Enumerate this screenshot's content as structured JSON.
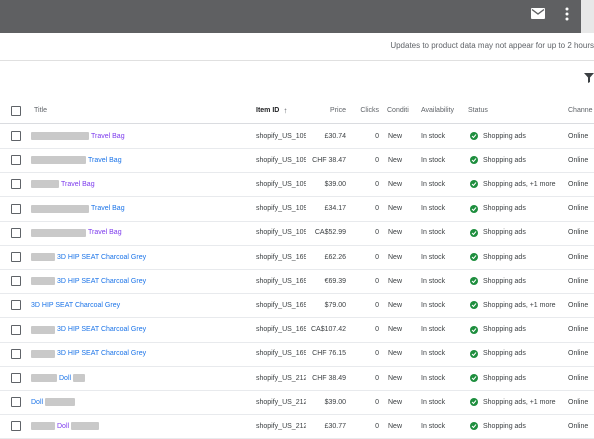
{
  "topbar": {
    "icons": [
      "mail-icon",
      "more-vert-icon"
    ]
  },
  "notice": "Updates to product data may not appear for up to 2 hours",
  "columns": {
    "title": "Title",
    "item_id": "Item ID",
    "price": "Price",
    "clicks": "Clicks",
    "condition": "Conditi",
    "availability": "Availability",
    "status": "Status",
    "channel": "Channe"
  },
  "rows": [
    {
      "title": "Travel Bag",
      "visited": true,
      "blur_lead": 58,
      "blur_tail": 0,
      "item_id": "shopify_US_109",
      "price": "£30.74",
      "clicks": "0",
      "condition": "New",
      "availability": "In stock",
      "status": "Shopping ads",
      "channel": "Online"
    },
    {
      "title": "Travel Bag",
      "visited": false,
      "blur_lead": 55,
      "blur_tail": 0,
      "item_id": "shopify_US_109",
      "price": "CHF 38.47",
      "clicks": "0",
      "condition": "New",
      "availability": "In stock",
      "status": "Shopping ads",
      "channel": "Online"
    },
    {
      "title": "Travel Bag",
      "visited": true,
      "blur_lead": 28,
      "blur_tail": 0,
      "item_id": "shopify_US_109",
      "price": "$39.00",
      "clicks": "0",
      "condition": "New",
      "availability": "In stock",
      "status": "Shopping ads, +1 more",
      "channel": "Online"
    },
    {
      "title": "Travel Bag",
      "visited": false,
      "blur_lead": 58,
      "blur_tail": 0,
      "item_id": "shopify_US_109",
      "price": "£34.17",
      "clicks": "0",
      "condition": "New",
      "availability": "In stock",
      "status": "Shopping ads",
      "channel": "Online"
    },
    {
      "title": "Travel Bag",
      "visited": true,
      "blur_lead": 55,
      "blur_tail": 0,
      "item_id": "shopify_US_109",
      "price": "CA$52.99",
      "clicks": "0",
      "condition": "New",
      "availability": "In stock",
      "status": "Shopping ads",
      "channel": "Online"
    },
    {
      "title": "3D HIP SEAT Charcoal Grey",
      "visited": false,
      "blur_lead": 24,
      "blur_tail": 0,
      "item_id": "shopify_US_169",
      "price": "£62.26",
      "clicks": "0",
      "condition": "New",
      "availability": "In stock",
      "status": "Shopping ads",
      "channel": "Online"
    },
    {
      "title": "3D HIP SEAT Charcoal Grey",
      "visited": false,
      "blur_lead": 24,
      "blur_tail": 0,
      "item_id": "shopify_US_169",
      "price": "€69.39",
      "clicks": "0",
      "condition": "New",
      "availability": "In stock",
      "status": "Shopping ads",
      "channel": "Online"
    },
    {
      "title": "3D HIP SEAT Charcoal Grey",
      "visited": false,
      "blur_lead": 0,
      "blur_tail": 0,
      "item_id": "shopify_US_169",
      "price": "$79.00",
      "clicks": "0",
      "condition": "New",
      "availability": "In stock",
      "status": "Shopping ads, +1 more",
      "channel": "Online"
    },
    {
      "title": "3D HIP SEAT Charcoal Grey",
      "visited": false,
      "blur_lead": 24,
      "blur_tail": 0,
      "item_id": "shopify_US_169",
      "price": "CA$107.42",
      "clicks": "0",
      "condition": "New",
      "availability": "In stock",
      "status": "Shopping ads",
      "channel": "Online"
    },
    {
      "title": "3D HIP SEAT Charcoal Grey",
      "visited": false,
      "blur_lead": 24,
      "blur_tail": 0,
      "item_id": "shopify_US_169",
      "price": "CHF 76.15",
      "clicks": "0",
      "condition": "New",
      "availability": "In stock",
      "status": "Shopping ads",
      "channel": "Online"
    },
    {
      "title": "Doll",
      "visited": false,
      "blur_lead": 26,
      "blur_tail": 12,
      "item_id": "shopify_US_212",
      "price": "CHF 38.49",
      "clicks": "0",
      "condition": "New",
      "availability": "In stock",
      "status": "Shopping ads",
      "channel": "Online"
    },
    {
      "title": "Doll",
      "visited": false,
      "blur_lead": 0,
      "blur_tail": 30,
      "item_id": "shopify_US_212",
      "price": "$39.00",
      "clicks": "0",
      "condition": "New",
      "availability": "In stock",
      "status": "Shopping ads, +1 more",
      "channel": "Online"
    },
    {
      "title": "Doll",
      "visited": true,
      "blur_lead": 24,
      "blur_tail": 28,
      "item_id": "shopify_US_212",
      "price": "£30.77",
      "clicks": "0",
      "condition": "New",
      "availability": "In stock",
      "status": "Shopping ads",
      "channel": "Online"
    }
  ],
  "colors": {
    "topbar": "#5f6062",
    "link": "#1a73e8",
    "visited_link": "#7c3aed",
    "status_ok": "#1e8e3e"
  }
}
